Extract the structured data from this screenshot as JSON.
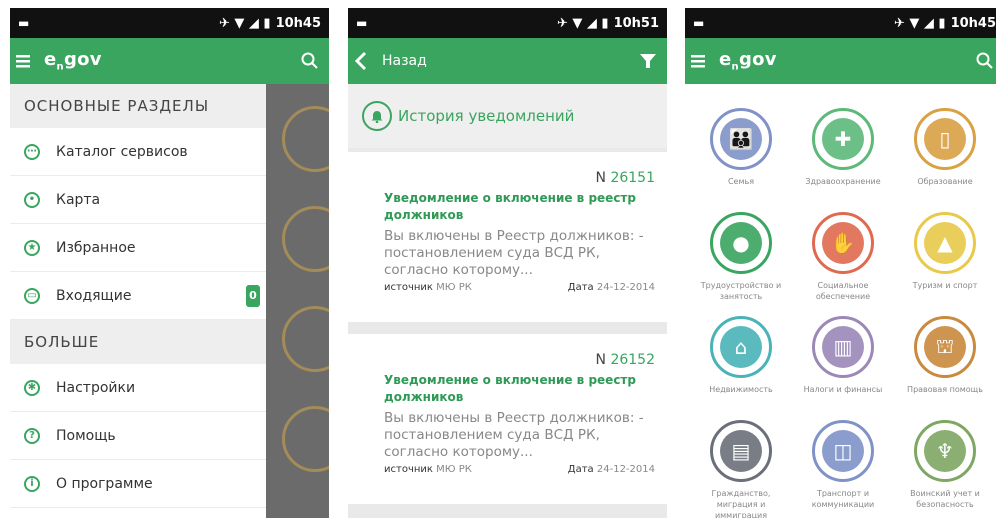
{
  "status": {
    "p1_time": "10h45",
    "p2_time": "10h51",
    "p3_time": "10h45"
  },
  "app": {
    "logo_main": "e",
    "logo_sub": "n",
    "logo_tail": "gov"
  },
  "drawer": {
    "section1": "ОСНОВНЫЕ РАЗДЕЛЫ",
    "items1": [
      {
        "label": "Каталог сервисов"
      },
      {
        "label": "Карта"
      },
      {
        "label": "Избранное"
      },
      {
        "label": "Входящие",
        "badge": "0"
      }
    ],
    "section2": "БОЛЬШЕ",
    "items2": [
      {
        "label": "Настройки"
      },
      {
        "label": "Помощь"
      },
      {
        "label": "О программе"
      }
    ]
  },
  "notifications": {
    "back_label": "Назад",
    "history": "История уведомлений",
    "cards": [
      {
        "number_prefix": "N",
        "number": "26151",
        "title": "Уведомление о включение в реестр должников",
        "text": "Вы включены в Реестр должников: - постановлением суда ВСД РК, согласно которому...",
        "source_label": "источник",
        "source": "МЮ РК",
        "date_label": "Дата",
        "date": "24-12-2014"
      },
      {
        "number_prefix": "N",
        "number": "26152",
        "title": "Уведомление о включение в реестр должников",
        "text": "Вы включены в Реестр должников: - постановлением суда ВСД РК, согласно которому...",
        "source_label": "источник",
        "source": "МЮ РК",
        "date_label": "Дата",
        "date": "24-12-2014"
      }
    ]
  },
  "categories": [
    {
      "label": "Семья",
      "color": "#7f93c8"
    },
    {
      "label": "Здравоохранение",
      "color": "#5db97a"
    },
    {
      "label": "Образование",
      "color": "#d9a044"
    },
    {
      "label": "Трудоустройство и занятость",
      "color": "#3aa55f"
    },
    {
      "label": "Социальное обеспечение",
      "color": "#e06a50"
    },
    {
      "label": "Туризм и спорт",
      "color": "#e8c94a"
    },
    {
      "label": "Недвижимость",
      "color": "#49b3b8"
    },
    {
      "label": "Налоги и финансы",
      "color": "#9b88b8"
    },
    {
      "label": "Правовая помощь",
      "color": "#c98a3e"
    },
    {
      "label": "Гражданство, миграция и иммиграция",
      "color": "#6a6f7a"
    },
    {
      "label": "Транспорт и коммуникации",
      "color": "#7f93c8"
    },
    {
      "label": "Воинский учет и безопасность",
      "color": "#7fa764"
    }
  ],
  "colors": {
    "accent": "#3aa55f",
    "statusbar": "#111111"
  }
}
